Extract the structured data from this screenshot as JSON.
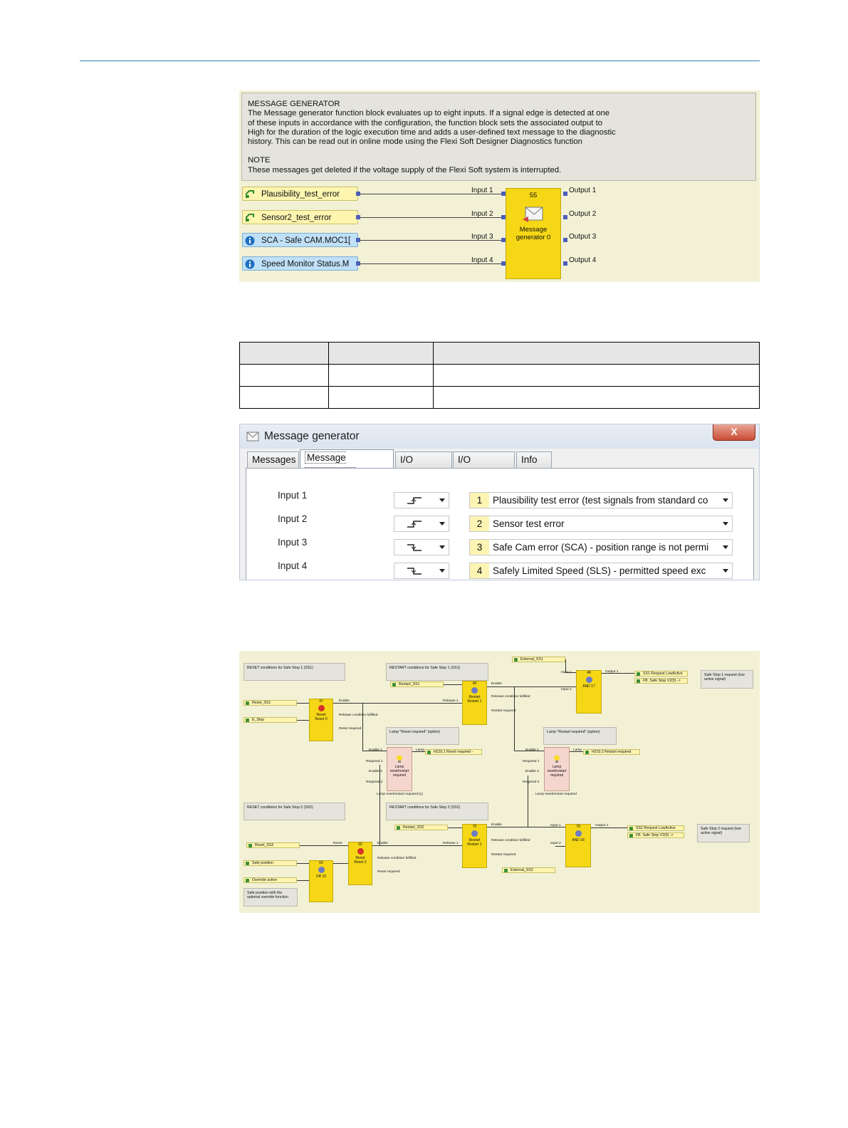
{
  "figure1": {
    "description": {
      "heading": "MESSAGE GENERATOR",
      "body_lines": [
        "The Message generator function block evaluates up to eight inputs. If a signal edge is detected at one",
        "of these inputs in accordance with the configuration, the function block sets the associated output to",
        "High for the duration of the logic execution time and adds a user-defined text message to the diagnostic",
        "history. This can be read out in online mode using the Flexi Soft Designer Diagnostics function"
      ],
      "note_heading": "NOTE",
      "note_text": "These messages get deleted if the voltage supply of the Flexi Soft system is interrupted."
    },
    "signals": [
      {
        "label": "Plausibility_test_error",
        "icon": "tag-icon"
      },
      {
        "label": "Sensor2_test_error",
        "icon": "tag-icon"
      },
      {
        "label": "SCA - Safe CAM.MOC1[",
        "icon": "info-icon"
      },
      {
        "label": "Speed Monitor Status.M",
        "icon": "info-icon"
      }
    ],
    "inputs": [
      "Input 1",
      "Input 2",
      "Input 3",
      "Input 4"
    ],
    "outputs": [
      "Output 1",
      "Output 2",
      "Output 3",
      "Output 4"
    ],
    "block": {
      "number": "55",
      "name_line1": "Message",
      "name_line2": "generator 0",
      "icon": "envelope-icon"
    }
  },
  "dialog": {
    "title": "Message generator",
    "close_label": "X",
    "tabs": [
      "Messages",
      "Message assignment",
      "I/O settings",
      "I/O comment",
      "Info"
    ],
    "active_tab": "Message assignment",
    "rows": [
      {
        "input": "Input 1",
        "edge": "rising-edge-icon",
        "num": "1",
        "message": "Plausibility test error (test signals from standard co"
      },
      {
        "input": "Input 2",
        "edge": "rising-edge-icon",
        "num": "2",
        "message": "Sensor test error"
      },
      {
        "input": "Input 3",
        "edge": "falling-edge-icon",
        "num": "3",
        "message": "Safe Cam error (SCA) - position range is not permi"
      },
      {
        "input": "Input 4",
        "edge": "falling-edge-icon",
        "num": "4",
        "message": "Safely Limited Speed (SLS) - permitted speed exc"
      }
    ]
  },
  "figure3": {
    "comments": {
      "reset_ss1": "RESET conditions for Safe Stop 1 (SS1)",
      "restart_ss1": "RESTART conditions for Safe Stop 1 (SS1)",
      "reset_ss2": "RESET conditions for Safe Stop 2 (SS2)",
      "restart_ss2": "RESTART conditions for Safe Stop 2 (SS2)",
      "lamp_reset": "Lamp \"Reset required\" (option)",
      "lamp_restart": "Lamp \"Restart required\" (option)",
      "ss1_request": "Safe Stop 1 request (low active signal)",
      "ss2_request": "Safe Stop 2 request (low active signal)",
      "safe_position": "Safe position with the optional override function"
    },
    "signals": {
      "external_ss1": "External_SS1",
      "restart_ss1": "Restart_SS1",
      "reset_ss1": "Reset_SS1",
      "e_stop": "E_Stop",
      "restart_ss2": "Restart_SS2",
      "reset_ss2": "Reset_SS2",
      "safe_position": "Safe position",
      "override_active": "Override active",
      "external_ss2": "External_SS2",
      "ss1_lowactive": "SS1 Request LowActive",
      "fb_ss_v2_1": "FB. Safe Stop V2(9) ->",
      "h210_1": "H210.1 Reset required -",
      "h210_2": "H210.2 Restart required",
      "ss2_lowactive": "SS2 Request LowActive",
      "fb_ss_v2_2": "FB. Safe Stop V2(9) ->"
    },
    "blocks": {
      "reset0": {
        "num": "47",
        "name": "Reset",
        "sub": "Reset 0"
      },
      "restart1": {
        "num": "40",
        "name": "Restart",
        "sub": "Restart 1"
      },
      "and17": {
        "num": "48",
        "name": "AND 17"
      },
      "lamp1": {
        "name": "Lamp reset/restart required"
      },
      "lamp2": {
        "name": "Lamp reset/restart required"
      },
      "restart2": {
        "num": "70",
        "name": "Restart",
        "sub": "Restart 1"
      },
      "and18": {
        "num": "79",
        "name": "AND 18"
      },
      "reset2": {
        "num": "60",
        "name": "Reset",
        "sub": "Reset 2"
      },
      "or15": {
        "num": "60",
        "name": "OR 15"
      }
    },
    "pin_labels": {
      "enable": "Enable",
      "release": "Release 1",
      "release_fulfilled": "Release condition fulfilled",
      "reset_required": "Reset required",
      "restart_required": "Restart required",
      "input1": "Input 1",
      "input2": "Input 2",
      "output1": "Output 1",
      "lamp": "Lamp",
      "enable1": "Enable 1",
      "enable2": "Enable 2",
      "required1": "Required 1",
      "required2": "Required 2",
      "lamp_required1": "Lamp reset/restart required [1]",
      "lamp_required": "Lamp reset/restart required",
      "reset": "Reset"
    }
  }
}
